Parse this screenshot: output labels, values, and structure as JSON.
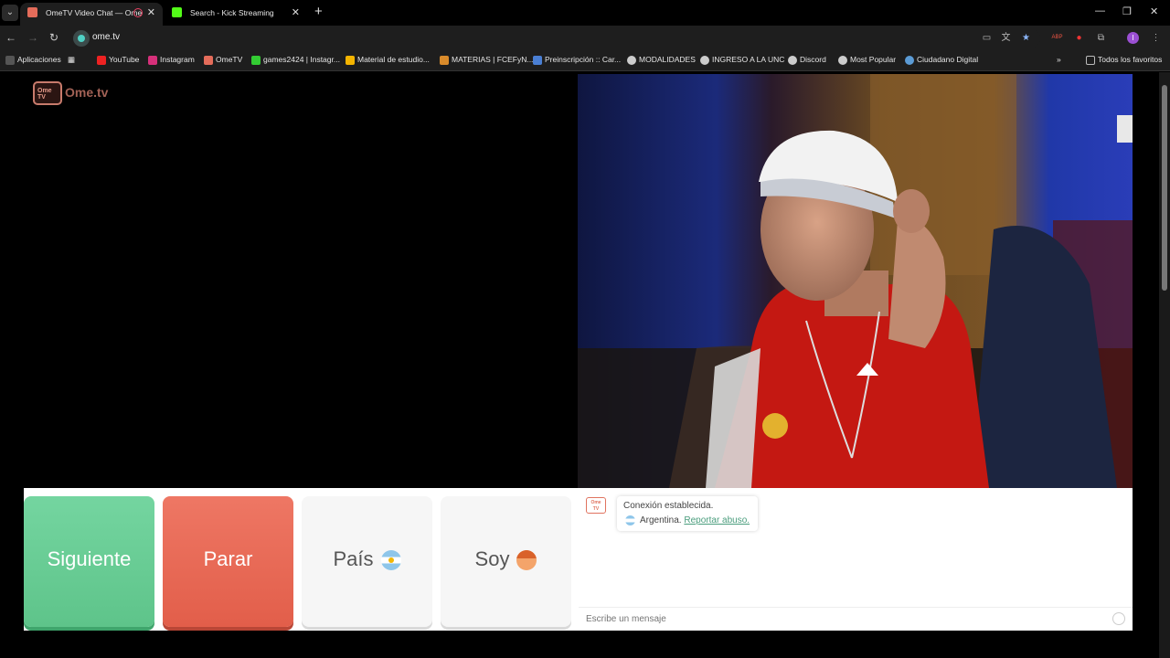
{
  "tabs": [
    {
      "title": "OmeTV Video Chat — Ome",
      "active": true
    },
    {
      "title": "Search - Kick Streaming",
      "active": false
    }
  ],
  "address_bar": {
    "url": "ome.tv"
  },
  "bookmarks": {
    "apps": "Aplicaciones",
    "items": [
      "YouTube",
      "Instagram",
      "OmeTV",
      "games2424 | Instagr...",
      "Material de estudio...",
      "MATERIAS | FCEFyN...",
      "Preinscripción :: Car...",
      "MODALIDADES",
      "INGRESO A LA UNC",
      "Discord",
      "Most Popular",
      "Ciudadano Digital"
    ],
    "all_favorites": "Todos los favoritos"
  },
  "page": {
    "logo_text": "Ome.tv",
    "logo_box_text": "Ome TV",
    "buttons": {
      "next": "Siguiente",
      "stop": "Parar",
      "country": "País",
      "me": "Soy"
    },
    "chat": {
      "status": "Conexión establecida.",
      "country": "Argentina.",
      "report_link": "Reportar abuso.",
      "input_placeholder": "Escribe un mensaje"
    }
  },
  "colors": {
    "next_green": "#6bcf96",
    "stop_red": "#e8674f",
    "link_green": "#4a9d7d"
  }
}
